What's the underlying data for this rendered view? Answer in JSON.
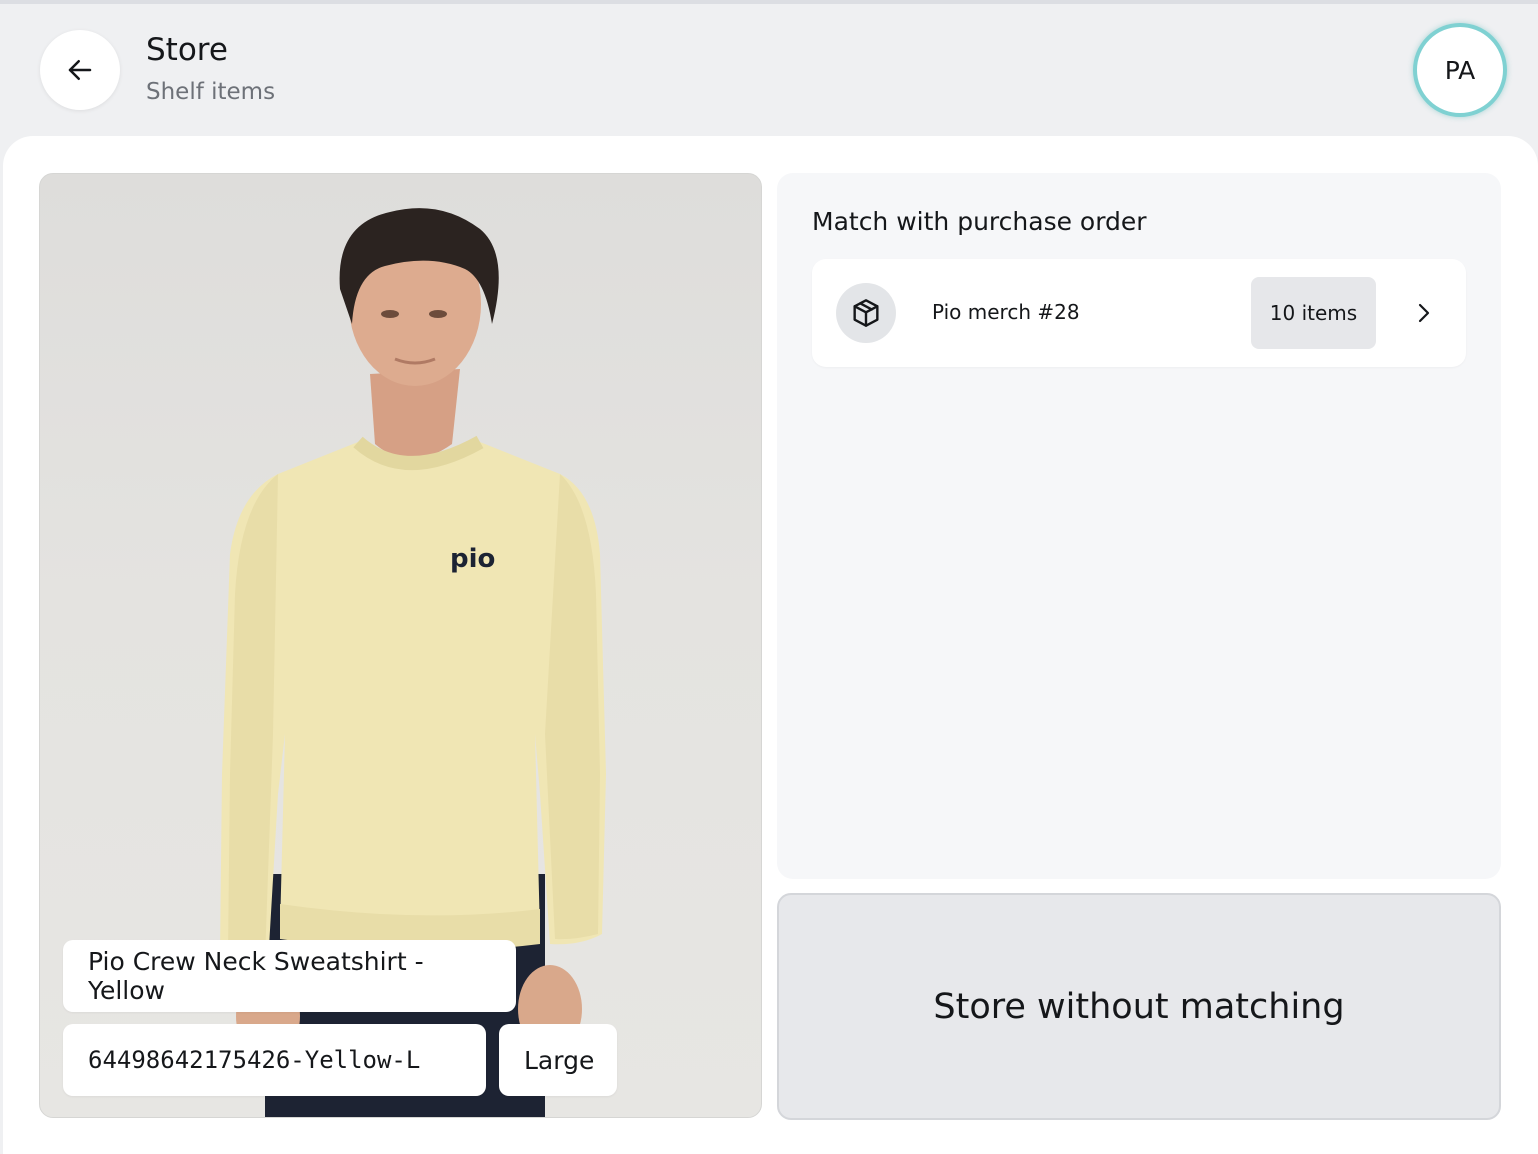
{
  "header": {
    "title": "Store",
    "subtitle": "Shelf items",
    "avatar_initials": "PA"
  },
  "product": {
    "name": "Pio Crew Neck Sweatshirt - Yellow",
    "sku": "64498642175426-Yellow-L",
    "size": "Large",
    "chest_logo_text": "pio",
    "colors": {
      "sweatshirt": "#f0e6b4",
      "background": "#e2e1de",
      "jeans": "#1d2333"
    }
  },
  "match": {
    "title": "Match with purchase order",
    "orders": [
      {
        "icon": "package-icon",
        "name": "Pio merch #28",
        "count_label": "10 items"
      }
    ]
  },
  "actions": {
    "store_without_matching": "Store without matching"
  },
  "colors": {
    "page_bg": "#eff0f2",
    "card_bg": "#f6f7f9",
    "avatar_ring": "#7fd1d2",
    "text": "#15171a",
    "muted_text": "#6d7178"
  }
}
